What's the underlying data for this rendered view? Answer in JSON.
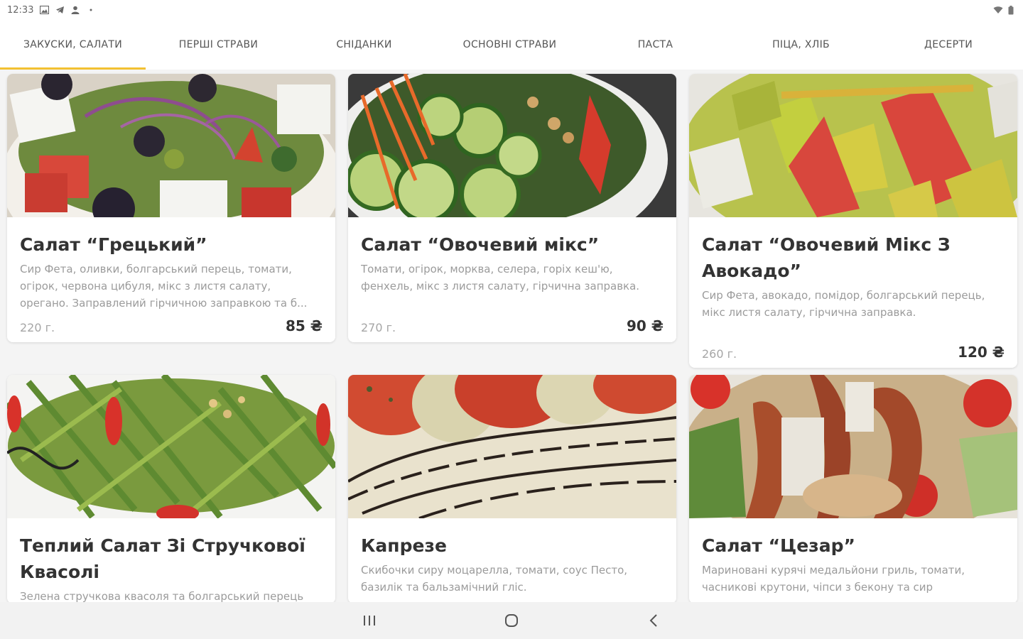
{
  "status_bar": {
    "time": "12:33",
    "left_icons": [
      "image-icon",
      "telegram-icon",
      "person-icon",
      "dot-icon"
    ],
    "right_icons": [
      "wifi-icon",
      "battery-icon"
    ]
  },
  "tabs": [
    {
      "label": "ЗАКУСКИ, САЛАТИ",
      "active": true
    },
    {
      "label": "ПЕРШІ СТРАВИ",
      "active": false
    },
    {
      "label": "СНІДАНКИ",
      "active": false
    },
    {
      "label": "ОСНОВНІ СТРАВИ",
      "active": false
    },
    {
      "label": "ПАСТА",
      "active": false
    },
    {
      "label": "ПІЦА, ХЛІБ",
      "active": false
    },
    {
      "label": "ДЕСЕРТИ",
      "active": false
    }
  ],
  "accent_color": "#f3c132",
  "dishes": [
    {
      "title": "Салат “Грецький”",
      "description": "Сир Фета, оливки, болгарський перець, томати, огірок, червона цибуля, мікс з листя салату, орегано. Заправлений гірчичною заправкою та б...",
      "weight": "220 г.",
      "price": "85 ₴",
      "image": "greek-salad-image"
    },
    {
      "title": "Салат “Овочевий мікс”",
      "description": "Томати, огірок, морква, селера, горіх кеш'ю, фенхель, мікс з листя салату, гірчична заправка.",
      "weight": "270 г.",
      "price": "90 ₴",
      "image": "vegetable-mix-image"
    },
    {
      "title": "Салат “Овочевий Мікс З Авокадо”",
      "description": "Сир Фета, авокадо, помідор, болгарський перець, мікс листя салату, гірчична заправка.",
      "weight": "260 г.",
      "price": "120 ₴",
      "image": "avocado-salad-image"
    },
    {
      "title": "Теплий Салат Зі Стручкової Квасолі",
      "description": "Зелена стручкова квасоля та болгарський перець",
      "weight": "",
      "price": "",
      "image": "green-bean-salad-image"
    },
    {
      "title": "Капрезе",
      "description": "Скибочки сиру моцарелла, томати, соус Песто, базилік та бальзамічний гліс.",
      "weight": "",
      "price": "",
      "image": "caprese-image"
    },
    {
      "title": "Салат “Цезар”",
      "description": "Мариновані курячі медальйони гриль, томати, часникові крутони, чіпси з бекону та сир",
      "weight": "",
      "price": "",
      "image": "caesar-salad-image"
    }
  ],
  "nav_bar": [
    "recents-icon",
    "home-icon",
    "back-icon"
  ]
}
